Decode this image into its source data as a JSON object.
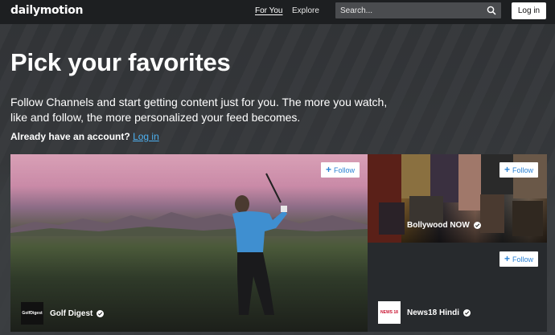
{
  "header": {
    "logo": "dailymotion",
    "nav": [
      "For You",
      "Explore"
    ],
    "search_placeholder": "Search...",
    "login_label": "Log in"
  },
  "hero": {
    "title": "Pick your favorites",
    "subtitle": "Follow Channels and start getting content just for you. The more you watch, like and follow, the more personalized your feed becomes.",
    "account_prompt": "Already have an account?",
    "account_link": "Log in"
  },
  "channels": [
    {
      "name": "Golf Digest",
      "logo_text": "GolfDigest",
      "follow_label": "Follow"
    },
    {
      "name": "Bollywood NOW",
      "follow_label": "Follow"
    },
    {
      "name": "News18 Hindi",
      "logo_text": "NEWS 18",
      "follow_label": "Follow"
    }
  ],
  "colors": {
    "header_bg": "#1d1f21",
    "link_blue": "#4db0f0",
    "follow_blue": "#2b82d4"
  }
}
